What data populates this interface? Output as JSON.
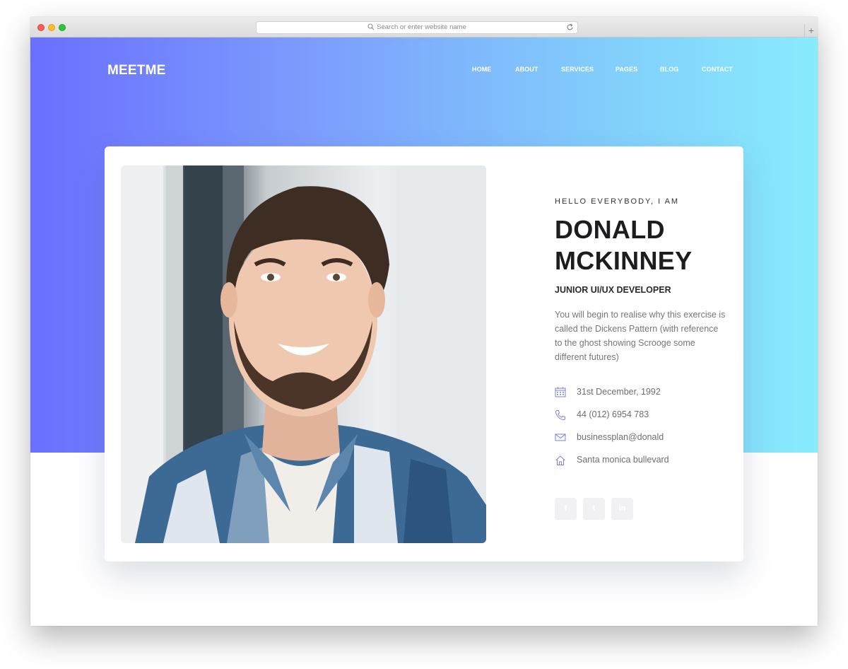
{
  "browser": {
    "url_placeholder": "Search or enter website name",
    "new_tab_symbol": "+"
  },
  "header": {
    "logo": "MEETME",
    "nav": [
      "HOME",
      "ABOUT",
      "SERVICES",
      "PAGES",
      "BLOG",
      "CONTACT"
    ]
  },
  "profile": {
    "greeting": "HELLO EVERYBODY, I AM",
    "name_line1": "DONALD",
    "name_line2": "MCKINNEY",
    "role": "JUNIOR UI/UX DEVELOPER",
    "bio": "You will begin to realise why this exercise is called the Dickens Pattern (with reference to the ghost showing Scrooge some different futures)",
    "details": [
      {
        "icon": "calendar-icon",
        "text": "31st December, 1992"
      },
      {
        "icon": "phone-icon",
        "text": "44 (012) 6954 783"
      },
      {
        "icon": "envelope-icon",
        "text": "businessplan@donald"
      },
      {
        "icon": "home-icon",
        "text": "Santa monica bullevard"
      }
    ],
    "socials": [
      {
        "icon": "facebook-icon",
        "glyph": "f"
      },
      {
        "icon": "twitter-icon",
        "glyph": "t"
      },
      {
        "icon": "linkedin-icon",
        "glyph": "in"
      }
    ]
  },
  "colors": {
    "gradient_start": "#6a6ffe",
    "gradient_end": "#88ecfc",
    "icon_accent": "#7b7fdd"
  }
}
